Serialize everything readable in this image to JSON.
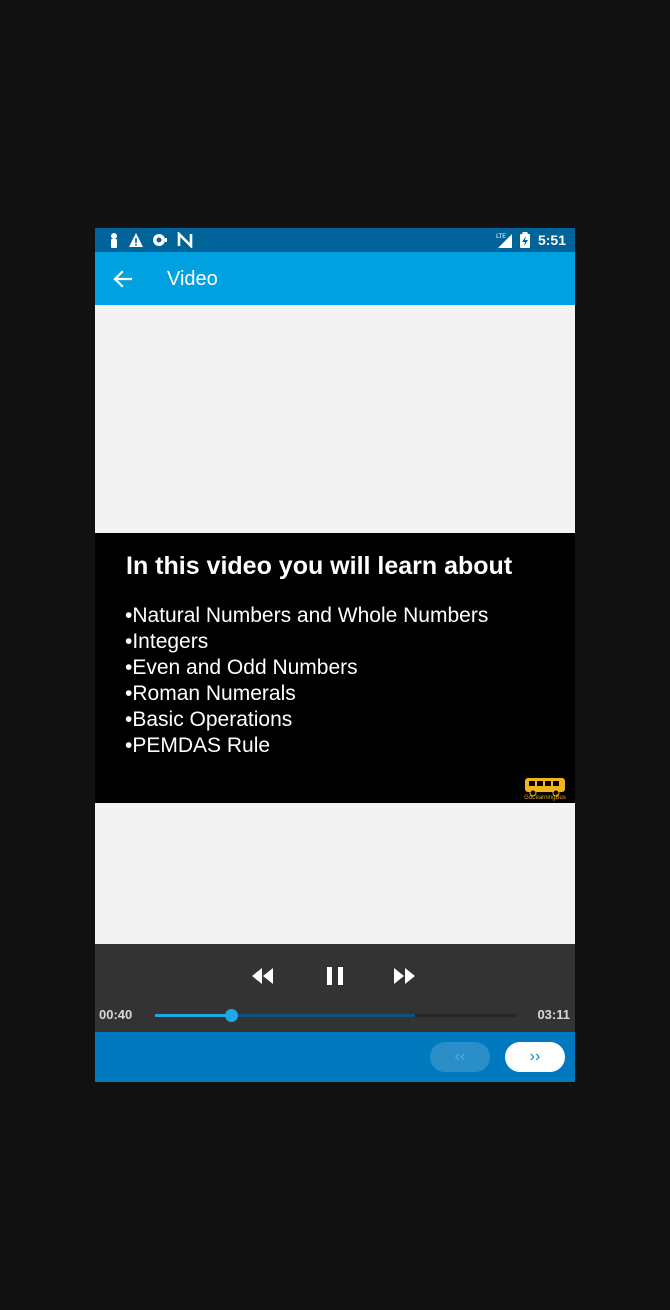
{
  "status_bar": {
    "time": "5:51",
    "left_icons": [
      "person-icon",
      "warning-icon",
      "record-icon",
      "n-icon"
    ],
    "right_icons": [
      "lte-signal-icon",
      "battery-charging-icon"
    ]
  },
  "app_bar": {
    "title": "Video",
    "color": "#00a1e0"
  },
  "video": {
    "heading": "In this video you will learn about",
    "topics": [
      "•Natural Numbers and Whole Numbers",
      "•Integers",
      "•Even and Odd Numbers",
      "•Roman Numerals",
      "•Basic Operations",
      "•PEMDAS Rule"
    ],
    "logo_caption": "GoLearningBus"
  },
  "player": {
    "current_time": "00:40",
    "total_time": "03:11",
    "progress": 0.21,
    "buffered": 0.72,
    "accent_color": "#1ea7e3"
  },
  "bottom_nav": {
    "prev_label": "‹‹",
    "next_label": "››"
  }
}
